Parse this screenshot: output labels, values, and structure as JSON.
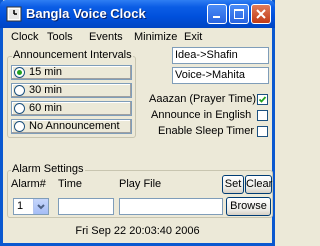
{
  "window": {
    "title": "Bangla Voice Clock"
  },
  "menu": [
    "Clock",
    "Tools",
    "Events",
    "Minimize",
    "Exit"
  ],
  "announcement": {
    "legend": "Announcement Intervals",
    "options": [
      {
        "label": "15 min",
        "selected": true
      },
      {
        "label": "30 min",
        "selected": false
      },
      {
        "label": "60 min",
        "selected": false
      },
      {
        "label": "No Announcement",
        "selected": false
      }
    ]
  },
  "voices": {
    "idea": "Idea->Shafin",
    "voice": "Voice->Mahita"
  },
  "options": [
    {
      "label": "Aaazan (Prayer Time)",
      "checked": true
    },
    {
      "label": "Announce in English",
      "checked": false
    },
    {
      "label": "Enable Sleep Timer",
      "checked": false
    }
  ],
  "alarm": {
    "legend": "Alarm Settings",
    "col_alarm": "Alarm#",
    "col_time": "Time",
    "col_file": "Play File",
    "selected_alarm": "1",
    "time_value": "",
    "file_value": "",
    "set_label": "Set",
    "clear_label": "Clear",
    "browse_label": "Browse"
  },
  "status": {
    "datetime": "Fri Sep 22 20:03:40 2006"
  },
  "colors": {
    "title_bar": "#0050dc",
    "window_bg": "#ece9d8",
    "radio_dot": "#21a121"
  }
}
